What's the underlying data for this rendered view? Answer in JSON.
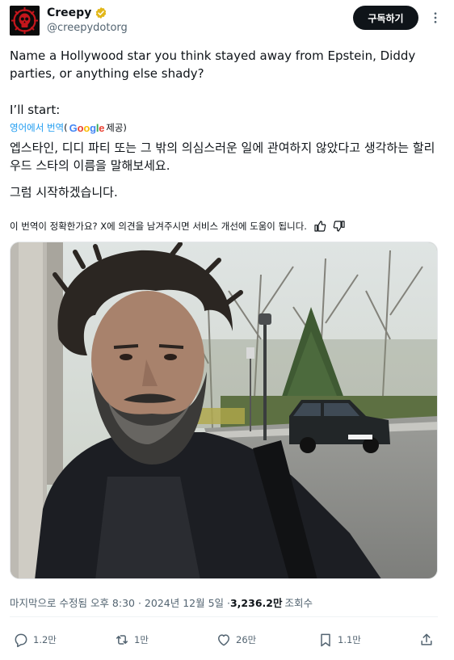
{
  "author": {
    "display_name": "Creepy",
    "handle": "@creepydotorg",
    "verified_color": "#e2b719",
    "avatar_color": "#c4161c"
  },
  "header": {
    "subscribe_label": "구독하기"
  },
  "tweet": {
    "line1": "Name a Hollywood star you think stayed away from Epstein, Diddy parties, or anything else shady?",
    "line2": "I’ll start:"
  },
  "translation": {
    "link_label": "영어에서 번역",
    "paren_open": "(",
    "google_logo": "Google",
    "provided_label": "제공)",
    "text1": "엡스타인, 디디 파티 또는 그 밖의 의심스러운 일에 관여하지 않았다고 생각하는 할리우드 스타의 이름을 말해보세요.",
    "text2": "그럼 시작하겠습니다.",
    "feedback_question": "이 번역이 정확한가요? X에 의견을 남겨주시면 서비스 개선에 도움이 됩니다."
  },
  "meta": {
    "timestamp": "마지막으로 수정됨 오후 8:30 · 2024년 12월 5일 · ",
    "views_count": "3,236.2만",
    "views_label": "조회수"
  },
  "actions": {
    "reply_count": "1.2만",
    "retweet_count": "1만",
    "like_count": "26만",
    "bookmark_count": "1.1만"
  },
  "colors": {
    "link_blue": "#1d9bf0",
    "secondary_text": "#536471",
    "primary_text": "#0f1419"
  }
}
